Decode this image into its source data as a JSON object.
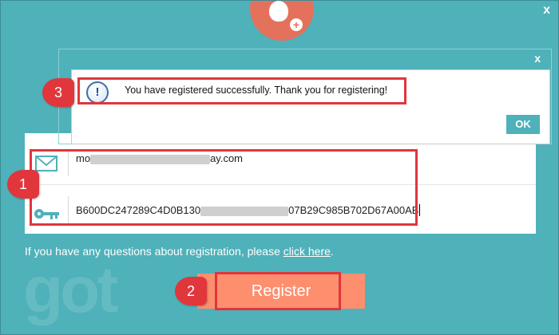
{
  "window": {
    "close_label": "x"
  },
  "dialog": {
    "close_label": "x",
    "message": "You have registered successfully. Thank you for registering!",
    "ok_label": "OK",
    "icon": "info-icon"
  },
  "form": {
    "email_visible_start": "mo",
    "email_visible_end": "ay.com",
    "key_visible_start": "B600DC247289C4D0B130",
    "key_visible_end": "07B29C985B702D67A00AB",
    "email_icon": "envelope-icon",
    "key_icon": "key-icon"
  },
  "help": {
    "text": "If you have any questions about registration, please ",
    "link_label": "click here",
    "suffix": "."
  },
  "register": {
    "label": "Register"
  },
  "callouts": [
    "1",
    "2",
    "3"
  ],
  "colors": {
    "background": "#4fb1b9",
    "accent": "#fd8f6f",
    "callout": "#e0363c",
    "avatar": "#e4715c"
  },
  "watermark": "got"
}
